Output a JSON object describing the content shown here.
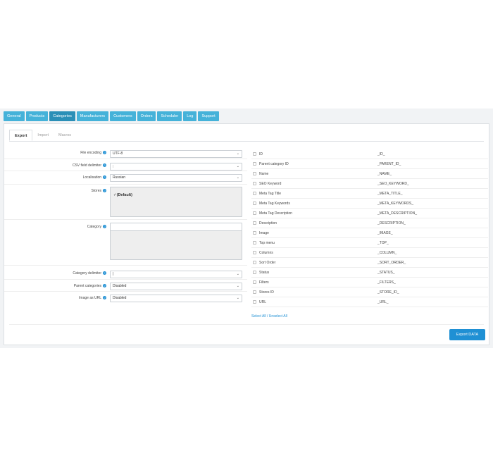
{
  "top_tabs": [
    "General",
    "Products",
    "Categories",
    "Manufacturers",
    "Customers",
    "Orders",
    "Scheduler",
    "Log",
    "Support"
  ],
  "sub_tabs": [
    "Export",
    "Import",
    "Macros"
  ],
  "form": {
    "file_encoding": {
      "label": "File encoding",
      "value": "UTF-8"
    },
    "csv_delimiter": {
      "label": "CSV field delimiter",
      "value": ";"
    },
    "localisation": {
      "label": "Localisation",
      "value": "Russian"
    },
    "stores": {
      "label": "Stores",
      "value": "(Default)",
      "check": "✓"
    },
    "category": {
      "label": "Category"
    },
    "category_delimiter": {
      "label": "Category delimiter",
      "value": "|"
    },
    "parent_categories": {
      "label": "Parent categories",
      "value": "Disabled"
    },
    "image_as_url": {
      "label": "Image as URL",
      "value": "Disabled"
    }
  },
  "help_glyph": "?",
  "chevron_glyph": "⌄",
  "fields": [
    {
      "name": "ID",
      "code": "_ID_"
    },
    {
      "name": "Parent category ID",
      "code": "_PARENT_ID_"
    },
    {
      "name": "Name",
      "code": "_NAME_"
    },
    {
      "name": "SEO Keyword",
      "code": "_SEO_KEYWORD_"
    },
    {
      "name": "Meta Tag Title",
      "code": "_META_TITLE_"
    },
    {
      "name": "Meta Tag Keywords",
      "code": "_META_KEYWORDS_"
    },
    {
      "name": "Meta Tag Description",
      "code": "_META_DESCRIPTION_"
    },
    {
      "name": "Description",
      "code": "_DESCRIPTION_"
    },
    {
      "name": "Image",
      "code": "_IMAGE_"
    },
    {
      "name": "Top menu",
      "code": "_TOP_"
    },
    {
      "name": "Columns",
      "code": "_COLUMN_"
    },
    {
      "name": "Sort Order",
      "code": "_SORT_ORDER_"
    },
    {
      "name": "Status",
      "code": "_STATUS_"
    },
    {
      "name": "Filters",
      "code": "_FILTERS_"
    },
    {
      "name": "Stores ID",
      "code": "_STORE_ID_"
    },
    {
      "name": "URL",
      "code": "_URL_"
    }
  ],
  "select_links": "Select All / Unselect All",
  "export_button": "Export DATA",
  "colors": {
    "tab": "#45b2d9",
    "tab_active": "#2a8fb7",
    "primary": "#1f90d4"
  }
}
